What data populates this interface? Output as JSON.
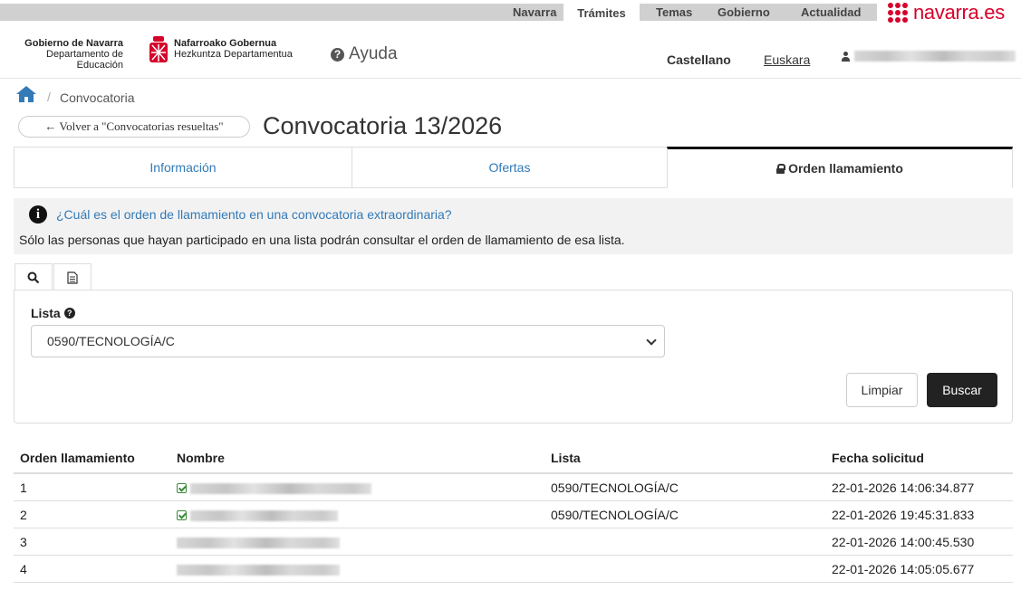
{
  "topnav": {
    "links": [
      "Navarra",
      "Trámites",
      "Temas",
      "Gobierno",
      "Actualidad"
    ],
    "active": "Trámites",
    "brand": "navarra.es",
    "brand_color": "#d6002a"
  },
  "header": {
    "gov_es_title": "Gobierno de Navarra",
    "gov_es_dept": "Departamento de Educación",
    "gov_eu_title": "Nafarroako Gobernua",
    "gov_eu_dept": "Hezkuntza Departamentua",
    "help_label": "Ayuda",
    "lang_active": "Castellano",
    "lang_other": "Euskara",
    "user_icon": "user-icon"
  },
  "breadcrumb": {
    "separator": "/",
    "current": "Convocatoria"
  },
  "back_button": "← Volver a \"Convocatorias resueltas\"",
  "page_title": "Convocatoria 13/2026",
  "tabs": [
    {
      "label": "Información"
    },
    {
      "label": "Ofertas"
    },
    {
      "label": "Orden llamamiento",
      "active": true
    }
  ],
  "info": {
    "link": "¿Cuál es el orden de llamamiento en una convocatoria extraordinaria?",
    "text": "Sólo las personas que hayan participado en una lista podrán consultar el orden de llamamiento de esa lista."
  },
  "filter": {
    "label": "Lista",
    "selected": "0590/TECNOLOGÍA/C",
    "clear_label": "Limpiar",
    "search_label": "Buscar"
  },
  "table": {
    "headers": [
      "Orden llamamiento",
      "Nombre",
      "Lista",
      "Fecha solicitud"
    ],
    "rows": [
      {
        "orden": "1",
        "checked": true,
        "lista": "0590/TECNOLOGÍA/C",
        "fecha": "22-01-2026 14:06:34.877"
      },
      {
        "orden": "2",
        "checked": true,
        "lista": "0590/TECNOLOGÍA/C",
        "fecha": "22-01-2026 19:45:31.833"
      },
      {
        "orden": "3",
        "checked": false,
        "lista": "",
        "fecha": "22-01-2026 14:00:45.530"
      },
      {
        "orden": "4",
        "checked": false,
        "lista": "",
        "fecha": "22-01-2026 14:05:05.677"
      }
    ]
  }
}
